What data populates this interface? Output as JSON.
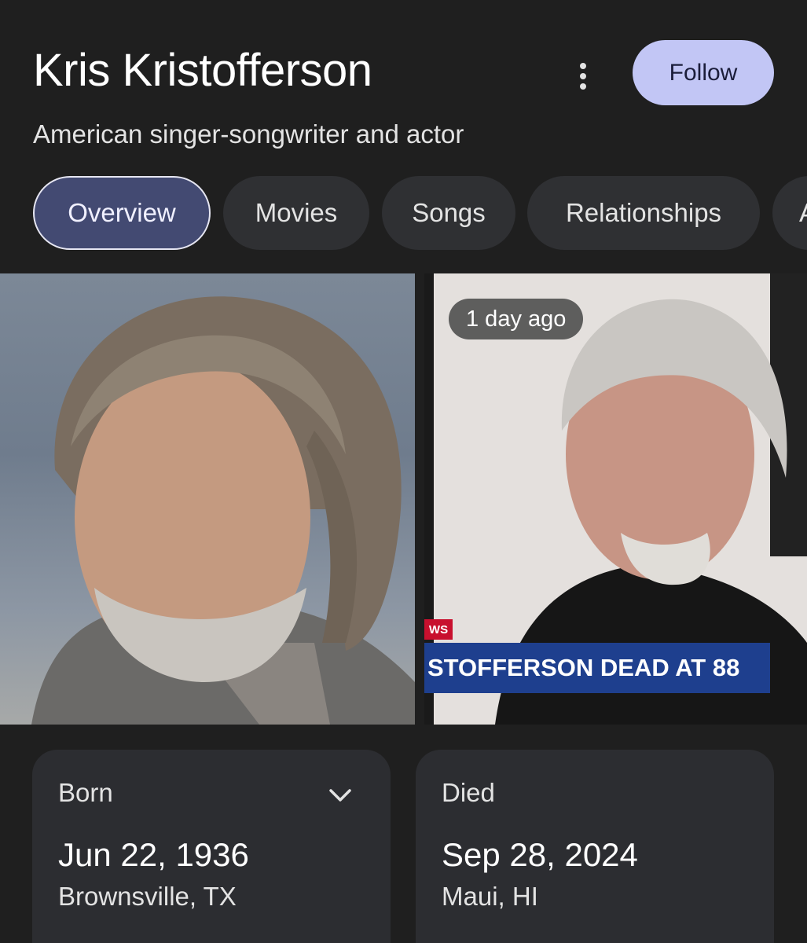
{
  "header": {
    "title": "Kris Kristofferson",
    "subtitle": "American singer-songwriter and actor",
    "follow_label": "Follow"
  },
  "tabs": [
    {
      "label": "Overview",
      "active": true
    },
    {
      "label": "Movies"
    },
    {
      "label": "Songs"
    },
    {
      "label": "Relationships"
    },
    {
      "label": "A"
    }
  ],
  "media": {
    "badge": "1 day ago",
    "ticker_tag": "WS",
    "ticker_text": "STOFFERSON DEAD AT 88"
  },
  "facts": {
    "born": {
      "label": "Born",
      "date": "Jun 22, 1936",
      "place": "Brownsville, TX"
    },
    "died": {
      "label": "Died",
      "date": "Sep 28, 2024",
      "place": "Maui, HI"
    }
  },
  "colors": {
    "background": "#1f1f1f",
    "follow_button": "#c2c6f5",
    "active_chip": "#434a72",
    "chip": "#2f3033",
    "card": "#2c2d31"
  }
}
